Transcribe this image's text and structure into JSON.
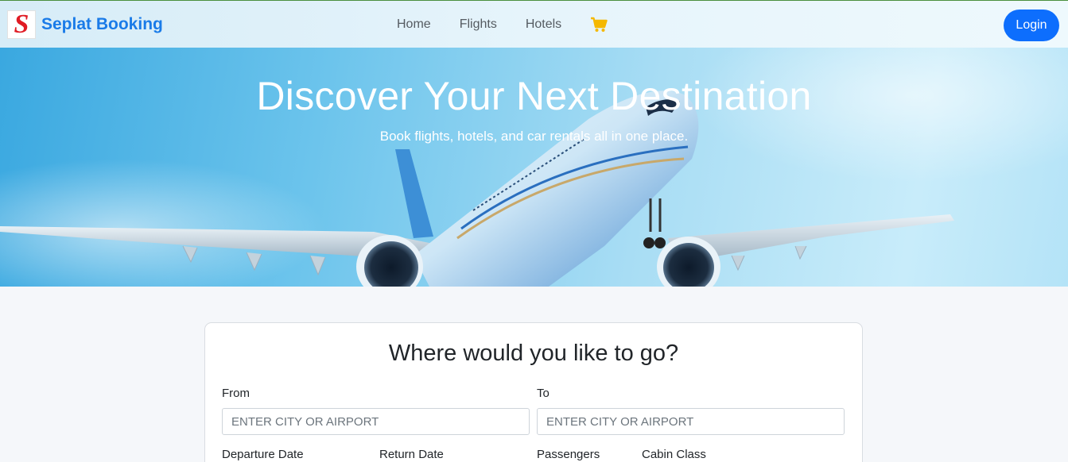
{
  "brand": {
    "logo_letter": "S",
    "name": "Seplat Booking"
  },
  "nav": {
    "links": [
      {
        "label": "Home"
      },
      {
        "label": "Flights"
      },
      {
        "label": "Hotels"
      }
    ],
    "cart_icon": "shopping-cart-icon",
    "login_label": "Login"
  },
  "hero": {
    "title": "Discover Your Next Destination",
    "subtitle": "Book flights, hotels, and car rentals all in one place."
  },
  "search": {
    "title": "Where would you like to go?",
    "from_label": "From",
    "from_placeholder": "ENTER CITY OR AIRPORT",
    "to_label": "To",
    "to_placeholder": "ENTER CITY OR AIRPORT",
    "departure_label": "Departure Date",
    "return_label": "Return Date",
    "passengers_label": "Passengers",
    "cabin_label": "Cabin Class"
  },
  "colors": {
    "primary": "#0d6efd",
    "brand_text": "#1a7be8",
    "logo_red": "#e01b24",
    "cart_yellow": "#f5b800"
  }
}
